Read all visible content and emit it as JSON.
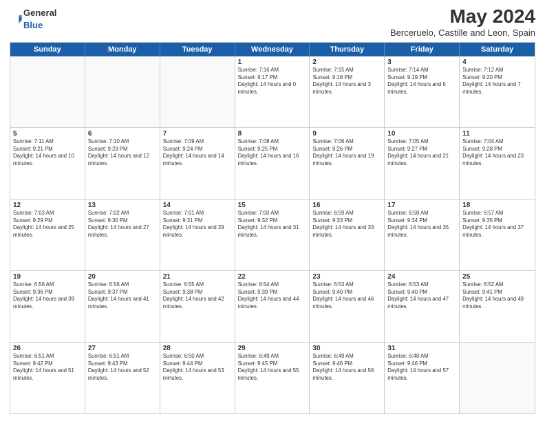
{
  "header": {
    "logo_general": "General",
    "logo_blue": "Blue",
    "month_title": "May 2024",
    "location": "Berceruelo, Castille and Leon, Spain"
  },
  "weekdays": [
    "Sunday",
    "Monday",
    "Tuesday",
    "Wednesday",
    "Thursday",
    "Friday",
    "Saturday"
  ],
  "weeks": [
    [
      {
        "day": "",
        "sunrise": "",
        "sunset": "",
        "daylight": ""
      },
      {
        "day": "",
        "sunrise": "",
        "sunset": "",
        "daylight": ""
      },
      {
        "day": "",
        "sunrise": "",
        "sunset": "",
        "daylight": ""
      },
      {
        "day": "1",
        "sunrise": "Sunrise: 7:16 AM",
        "sunset": "Sunset: 9:17 PM",
        "daylight": "Daylight: 14 hours and 0 minutes."
      },
      {
        "day": "2",
        "sunrise": "Sunrise: 7:15 AM",
        "sunset": "Sunset: 9:18 PM",
        "daylight": "Daylight: 14 hours and 3 minutes."
      },
      {
        "day": "3",
        "sunrise": "Sunrise: 7:14 AM",
        "sunset": "Sunset: 9:19 PM",
        "daylight": "Daylight: 14 hours and 5 minutes."
      },
      {
        "day": "4",
        "sunrise": "Sunrise: 7:12 AM",
        "sunset": "Sunset: 9:20 PM",
        "daylight": "Daylight: 14 hours and 7 minutes."
      }
    ],
    [
      {
        "day": "5",
        "sunrise": "Sunrise: 7:11 AM",
        "sunset": "Sunset: 9:21 PM",
        "daylight": "Daylight: 14 hours and 10 minutes."
      },
      {
        "day": "6",
        "sunrise": "Sunrise: 7:10 AM",
        "sunset": "Sunset: 9:23 PM",
        "daylight": "Daylight: 14 hours and 12 minutes."
      },
      {
        "day": "7",
        "sunrise": "Sunrise: 7:09 AM",
        "sunset": "Sunset: 9:24 PM",
        "daylight": "Daylight: 14 hours and 14 minutes."
      },
      {
        "day": "8",
        "sunrise": "Sunrise: 7:08 AM",
        "sunset": "Sunset: 9:25 PM",
        "daylight": "Daylight: 14 hours and 16 minutes."
      },
      {
        "day": "9",
        "sunrise": "Sunrise: 7:06 AM",
        "sunset": "Sunset: 9:26 PM",
        "daylight": "Daylight: 14 hours and 19 minutes."
      },
      {
        "day": "10",
        "sunrise": "Sunrise: 7:05 AM",
        "sunset": "Sunset: 9:27 PM",
        "daylight": "Daylight: 14 hours and 21 minutes."
      },
      {
        "day": "11",
        "sunrise": "Sunrise: 7:04 AM",
        "sunset": "Sunset: 9:28 PM",
        "daylight": "Daylight: 14 hours and 23 minutes."
      }
    ],
    [
      {
        "day": "12",
        "sunrise": "Sunrise: 7:03 AM",
        "sunset": "Sunset: 9:29 PM",
        "daylight": "Daylight: 14 hours and 25 minutes."
      },
      {
        "day": "13",
        "sunrise": "Sunrise: 7:02 AM",
        "sunset": "Sunset: 9:30 PM",
        "daylight": "Daylight: 14 hours and 27 minutes."
      },
      {
        "day": "14",
        "sunrise": "Sunrise: 7:01 AM",
        "sunset": "Sunset: 9:31 PM",
        "daylight": "Daylight: 14 hours and 29 minutes."
      },
      {
        "day": "15",
        "sunrise": "Sunrise: 7:00 AM",
        "sunset": "Sunset: 9:32 PM",
        "daylight": "Daylight: 14 hours and 31 minutes."
      },
      {
        "day": "16",
        "sunrise": "Sunrise: 6:59 AM",
        "sunset": "Sunset: 9:33 PM",
        "daylight": "Daylight: 14 hours and 33 minutes."
      },
      {
        "day": "17",
        "sunrise": "Sunrise: 6:58 AM",
        "sunset": "Sunset: 9:34 PM",
        "daylight": "Daylight: 14 hours and 35 minutes."
      },
      {
        "day": "18",
        "sunrise": "Sunrise: 6:57 AM",
        "sunset": "Sunset: 9:35 PM",
        "daylight": "Daylight: 14 hours and 37 minutes."
      }
    ],
    [
      {
        "day": "19",
        "sunrise": "Sunrise: 6:56 AM",
        "sunset": "Sunset: 9:36 PM",
        "daylight": "Daylight: 14 hours and 39 minutes."
      },
      {
        "day": "20",
        "sunrise": "Sunrise: 6:56 AM",
        "sunset": "Sunset: 9:37 PM",
        "daylight": "Daylight: 14 hours and 41 minutes."
      },
      {
        "day": "21",
        "sunrise": "Sunrise: 6:55 AM",
        "sunset": "Sunset: 9:38 PM",
        "daylight": "Daylight: 14 hours and 42 minutes."
      },
      {
        "day": "22",
        "sunrise": "Sunrise: 6:54 AM",
        "sunset": "Sunset: 9:39 PM",
        "daylight": "Daylight: 14 hours and 44 minutes."
      },
      {
        "day": "23",
        "sunrise": "Sunrise: 6:53 AM",
        "sunset": "Sunset: 9:40 PM",
        "daylight": "Daylight: 14 hours and 46 minutes."
      },
      {
        "day": "24",
        "sunrise": "Sunrise: 6:53 AM",
        "sunset": "Sunset: 9:40 PM",
        "daylight": "Daylight: 14 hours and 47 minutes."
      },
      {
        "day": "25",
        "sunrise": "Sunrise: 6:52 AM",
        "sunset": "Sunset: 9:41 PM",
        "daylight": "Daylight: 14 hours and 49 minutes."
      }
    ],
    [
      {
        "day": "26",
        "sunrise": "Sunrise: 6:51 AM",
        "sunset": "Sunset: 9:42 PM",
        "daylight": "Daylight: 14 hours and 51 minutes."
      },
      {
        "day": "27",
        "sunrise": "Sunrise: 6:51 AM",
        "sunset": "Sunset: 9:43 PM",
        "daylight": "Daylight: 14 hours and 52 minutes."
      },
      {
        "day": "28",
        "sunrise": "Sunrise: 6:50 AM",
        "sunset": "Sunset: 9:44 PM",
        "daylight": "Daylight: 14 hours and 53 minutes."
      },
      {
        "day": "29",
        "sunrise": "Sunrise: 6:49 AM",
        "sunset": "Sunset: 9:45 PM",
        "daylight": "Daylight: 14 hours and 55 minutes."
      },
      {
        "day": "30",
        "sunrise": "Sunrise: 6:49 AM",
        "sunset": "Sunset: 9:46 PM",
        "daylight": "Daylight: 14 hours and 56 minutes."
      },
      {
        "day": "31",
        "sunrise": "Sunrise: 6:48 AM",
        "sunset": "Sunset: 9:46 PM",
        "daylight": "Daylight: 14 hours and 57 minutes."
      },
      {
        "day": "",
        "sunrise": "",
        "sunset": "",
        "daylight": ""
      }
    ]
  ]
}
